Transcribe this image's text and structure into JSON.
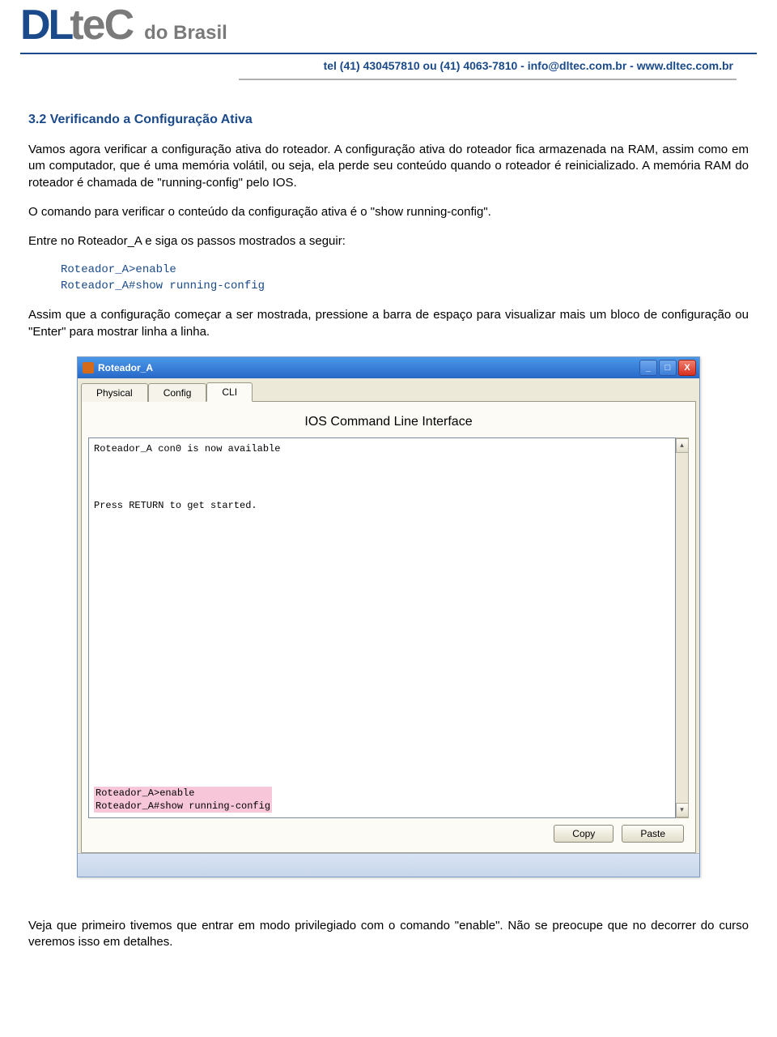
{
  "header": {
    "logo_dl": "DL",
    "logo_tec": "teC",
    "brasil": "do Brasil",
    "contact": "tel (41) 430457810 ou (41) 4063-7810 - info@dltec.com.br - www.dltec.com.br"
  },
  "section": {
    "title": "3.2 Verificando a Configuração Ativa",
    "p1": "Vamos agora verificar a configuração ativa do roteador. A configuração ativa do roteador fica armazenada na RAM, assim como em um computador, que é uma memória volátil, ou seja, ela perde seu conteúdo quando o roteador é reinicializado. A memória RAM do roteador é chamada de \"running-config\" pelo IOS.",
    "p2": "O comando para verificar o conteúdo da configuração ativa é o \"show running-config\".",
    "p3": "Entre no Roteador_A e siga os passos mostrados a seguir:",
    "cmd1": "Roteador_A>enable",
    "cmd2": "Roteador_A#show running-config",
    "p4": "Assim que a configuração começar a ser mostrada, pressione a barra de espaço para visualizar mais um bloco de configuração ou \"Enter\" para mostrar linha a linha."
  },
  "window": {
    "title": "Roteador_A",
    "tabs": {
      "physical": "Physical",
      "config": "Config",
      "cli": "CLI"
    },
    "cli_title": "IOS Command Line Interface",
    "cli_line1": "Roteador_A con0 is now available",
    "cli_line2": "Press RETURN to get started.",
    "hl1": "Roteador_A>enable",
    "hl2": "Roteador_A#show running-config",
    "copy": "Copy",
    "paste": "Paste",
    "min": "_",
    "max": "□",
    "close": "X",
    "scroll_up": "▴",
    "scroll_down": "▾"
  },
  "after": {
    "p": "Veja que primeiro tivemos que entrar em modo privilegiado com o comando \"enable\". Não se preocupe que no decorrer do curso veremos isso em detalhes."
  }
}
